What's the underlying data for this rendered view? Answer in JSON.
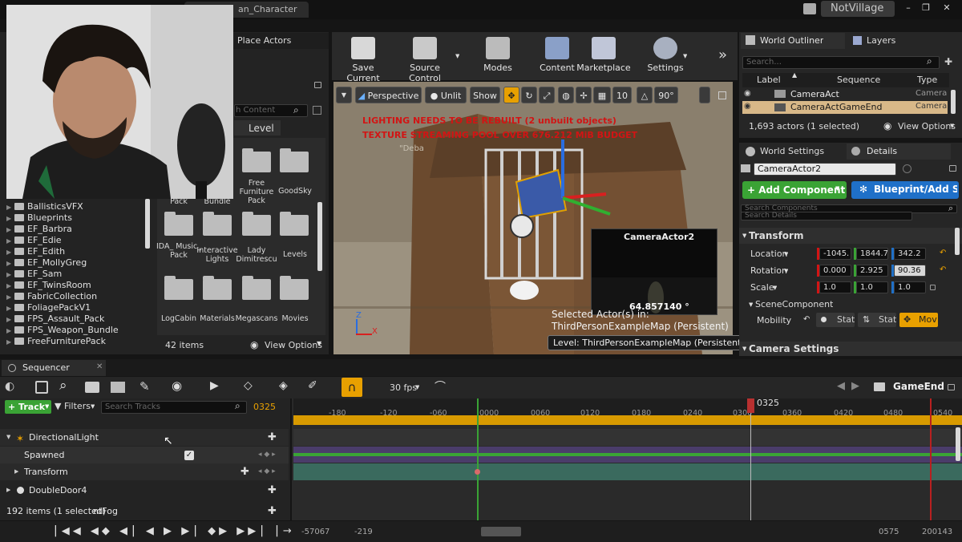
{
  "window": {
    "tab_title": "an_Character",
    "project": "NotVillage"
  },
  "left": {
    "place_actors_tab": "Place Actors",
    "search_placeholder": "h Content",
    "level_header": "Level",
    "tree": [
      "BallisticsVFX",
      "Blueprints",
      "EF_Barbra",
      "EF_Edie",
      "EF_Edith",
      "EF_MollyGreg",
      "EF_Sam",
      "EF_TwinsRoom",
      "FabricCollection",
      "FoliagePackV1",
      "FPS_Assault_Pack",
      "FPS_Weapon_Bundle",
      "FreeFurniturePack"
    ],
    "folders_row1": [
      "Pack",
      "Bundle",
      "Free Furniture Pack",
      "GoodSky"
    ],
    "folders_row2": [
      "IDA_ Music_ Pack",
      "Interactive Lights",
      "Lady Dimitrescu",
      "Levels"
    ],
    "folders_row3": [
      "LogCabin",
      "Materials",
      "Megascans",
      "Movies"
    ],
    "items_count": "42 items",
    "view_options": "View Options"
  },
  "toolbar": {
    "save_current": "Save Current",
    "source_control": "Source Control",
    "modes": "Modes",
    "content": "Content",
    "marketplace": "Marketplace",
    "settings": "Settings"
  },
  "viewport": {
    "perspective": "Perspective",
    "unlit": "Unlit",
    "show": "Show",
    "grid_snap": "10",
    "rot_snap": "90°",
    "warn1": "LIGHTING NEEDS TO BE REBUILT (2 unbuilt objects)",
    "warn2": "TEXTURE STREAMING POOL OVER 676.212 MiB BUDGET",
    "debug": "\"Deba",
    "preview_title": "CameraActor2",
    "preview_value": "64.857140 °",
    "selected_line1": "Selected Actor(s) in:",
    "selected_line2": "ThirdPersonExampleMap (Persistent)",
    "level_label": "Level:  ThirdPersonExampleMap (Persistent)",
    "axis_z": "Z",
    "axis_x": "X"
  },
  "outliner": {
    "tab": "World Outliner",
    "layers_tab": "Layers",
    "search_placeholder": "Search...",
    "col_label": "Label",
    "col_sequence": "Sequence",
    "col_type": "Type",
    "rows": [
      {
        "label": "CameraAct",
        "type": "Camera"
      },
      {
        "label": "CameraActGameEnd",
        "type": "Camera"
      }
    ],
    "actor_count": "1,693 actors (1 selected)",
    "view_options": "View Options"
  },
  "details": {
    "world_settings_tab": "World Settings",
    "details_tab": "Details",
    "name": "CameraActor2",
    "add_component": "+ Add Component",
    "blueprint": "Blueprint/Add Sc",
    "search_components": "Search Components",
    "search_details": "Search Details",
    "transform": "Transform",
    "location_label": "Location",
    "rotation_label": "Rotation",
    "scale_label": "Scale",
    "location": [
      "-1045.",
      "1844.7",
      "342.2"
    ],
    "rotation": [
      "0.000",
      "2.925",
      "90.36"
    ],
    "scale": [
      "1.0",
      "1.0",
      "1.0"
    ],
    "scene_component": "SceneComponent",
    "mobility": "Mobility",
    "stat1": "Stat",
    "stat2": "Stat",
    "mov": "Mov",
    "camera_settings": "Camera Settings"
  },
  "sequencer": {
    "tab": "Sequencer",
    "fps": "30 fps",
    "sequence_name": "GameEnd",
    "track_btn": "+ Track",
    "filters_btn": "Filters",
    "search_placeholder": "Search Tracks",
    "current_frame": "0325",
    "playhead_label": "0325",
    "ticks": [
      "-180",
      "-120",
      "-060",
      "0000",
      "0060",
      "0120",
      "0180",
      "0240",
      "0300",
      "0360",
      "0420",
      "0480",
      "0540"
    ],
    "rows": [
      {
        "label": "DirectionalLight"
      },
      {
        "label": "Spawned"
      },
      {
        "label": "Transform"
      },
      {
        "label": "DoubleDoor4"
      },
      {
        "label": "ntFog"
      }
    ],
    "items_count": "192 items (1 selected)",
    "bottom_left": "-57067",
    "bottom_left2": "-219",
    "bottom_right1": "0575",
    "bottom_right2": "200143"
  },
  "colors": {
    "accent_orange": "#e8a000",
    "add_component_green": "#3aa335",
    "blueprint_blue": "#1f70c8",
    "warning_red": "#d21414"
  }
}
